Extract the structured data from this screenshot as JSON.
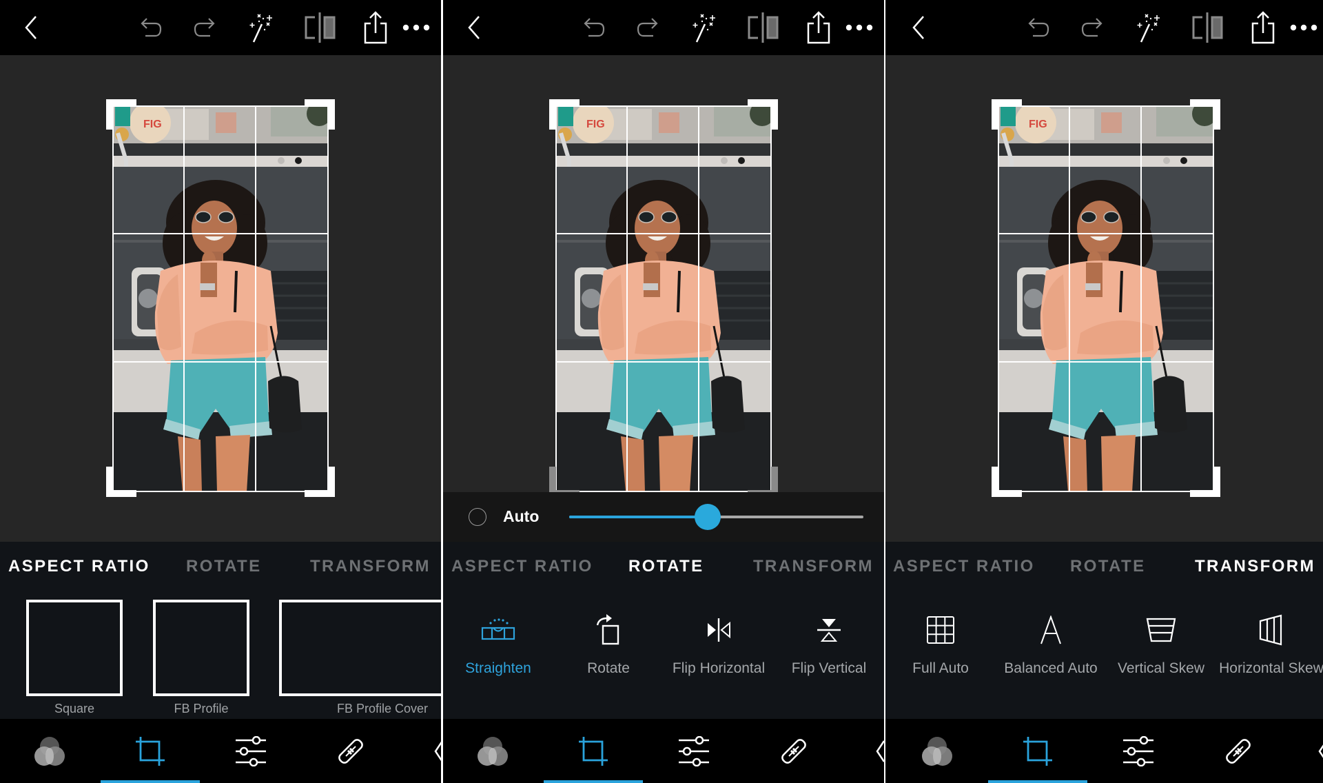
{
  "accent_color": "#2aa3dc",
  "toolbar": {
    "icons": [
      "back-icon",
      "undo-icon",
      "redo-icon",
      "auto-enhance-wand-icon",
      "before-after-compare-icon",
      "share-icon",
      "more-icon"
    ]
  },
  "tabs": [
    "ASPECT RATIO",
    "ROTATE",
    "TRANSFORM"
  ],
  "panels": [
    {
      "active_tab": "ASPECT RATIO",
      "aspect_ratios": [
        {
          "label": "Square",
          "ratio": "1:1"
        },
        {
          "label": "FB Profile",
          "ratio": "1:1"
        },
        {
          "label": "FB Profile Cover",
          "label_visible": "FB Profile Cov",
          "ratio": "wide"
        }
      ]
    },
    {
      "active_tab": "ROTATE",
      "slider": {
        "auto_label": "Auto",
        "auto_checked": false,
        "value_fraction": 0.47
      },
      "tools": [
        {
          "label": "Straighten",
          "icon": "straighten-level-icon",
          "active": true
        },
        {
          "label": "Rotate",
          "icon": "rotate-icon",
          "active": false
        },
        {
          "label": "Flip Horizontal",
          "icon": "flip-horizontal-icon",
          "active": false
        },
        {
          "label": "Flip Vertical",
          "icon": "flip-vertical-icon",
          "active": false
        }
      ]
    },
    {
      "active_tab": "TRANSFORM",
      "tools": [
        {
          "label": "Full Auto",
          "icon": "full-auto-grid-icon",
          "active": false
        },
        {
          "label": "Balanced Auto",
          "icon": "balanced-auto-icon",
          "active": false
        },
        {
          "label": "Vertical Skew",
          "icon": "vertical-skew-icon",
          "active": false
        },
        {
          "label": "Horizontal Skew",
          "icon": "horizontal-skew-icon",
          "active": false
        }
      ]
    }
  ],
  "bottom_nav": {
    "items": [
      "looks-icon",
      "crop-icon",
      "adjustments-icon",
      "heal-icon",
      "more-tools-icon"
    ],
    "active": "crop-icon"
  },
  "photo": {
    "subject": "smiling woman in peach sweater and teal denim shorts in front of grey van",
    "sticker_text": "FIG"
  }
}
